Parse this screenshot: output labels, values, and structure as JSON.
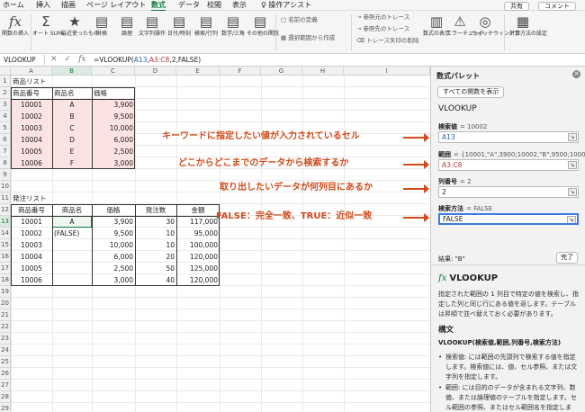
{
  "tabs": [
    "ホーム",
    "挿入",
    "描画",
    "ページ レイアウト",
    "数式",
    "データ",
    "校閲",
    "表示",
    "操作アシスト"
  ],
  "active_tab": "数式",
  "top_right": {
    "share": "共有",
    "comment": "コメント"
  },
  "ribbon": {
    "insert_function": "関数の挿入",
    "autosum": "オート SUM",
    "recent": "最近使ったもの",
    "financial": "財務",
    "logical": "論理",
    "text": "文字列操作",
    "datetime": "日付/時刻",
    "lookup": "検索/行列",
    "math": "数学/三角",
    "more": "その他の関数",
    "define_name": "名前の定義",
    "create_from_selection": "選択範囲から作成",
    "trace_precedents": "参照元のトレース",
    "trace_dependents": "参照先のトレース",
    "remove_arrows": "トレース矢印の削除",
    "show_formulas": "数式の表示",
    "error_check": "エラーチェック",
    "watch": "ウォッチウィンドウ",
    "calc_options": "計算方法の設定"
  },
  "formula_bar": {
    "name_box": "VLOOKUP",
    "fx": "fx",
    "formula_pre": "=VLOOKUP(",
    "formula_arg1": "A13",
    "formula_sep": ",",
    "formula_arg2": "A3:C8",
    "formula_post": ",2,FALSE)"
  },
  "columns": [
    "A",
    "B",
    "C",
    "D",
    "E",
    "F",
    "G",
    "H",
    "I"
  ],
  "rows": [
    "1",
    "2",
    "3",
    "4",
    "5",
    "6",
    "7",
    "8",
    "9",
    "10",
    "11",
    "12",
    "13",
    "14",
    "15",
    "16",
    "17",
    "18",
    "19",
    "20",
    "21",
    "22",
    "23",
    "24",
    "25",
    "26",
    "27",
    "28",
    "29"
  ],
  "product_list": {
    "title": "商品リスト",
    "headers": [
      "商品番号",
      "商品名",
      "価格"
    ],
    "rows": [
      [
        "10001",
        "A",
        "3,900"
      ],
      [
        "10002",
        "B",
        "9,500"
      ],
      [
        "10003",
        "C",
        "10,000"
      ],
      [
        "10004",
        "D",
        "6,000"
      ],
      [
        "10005",
        "E",
        "2,500"
      ],
      [
        "10006",
        "F",
        "3,000"
      ]
    ]
  },
  "order_list": {
    "title": "発注リスト",
    "headers": [
      "商品番号",
      "商品名",
      "価格",
      "発注数",
      "金額"
    ],
    "rows": [
      [
        "10001",
        "A",
        "3,900",
        "30",
        "117,000"
      ],
      [
        "10002",
        "(FALSE)",
        "9,500",
        "10",
        "95,000"
      ],
      [
        "10003",
        "",
        "10,000",
        "10",
        "100,000"
      ],
      [
        "10004",
        "",
        "6,000",
        "20",
        "120,000"
      ],
      [
        "10005",
        "",
        "2,500",
        "50",
        "125,000"
      ],
      [
        "10006",
        "",
        "3,000",
        "40",
        "120,000"
      ]
    ]
  },
  "annotations": [
    "キーワードに指定したい値が入力されているセル",
    "どこからどこまでのデータから検索するか",
    "取り出したいデータが何列目にあるか",
    "FALSE：完全一致、TRUE：近似一致"
  ],
  "panel": {
    "title": "数式パレット",
    "all_functions": "すべての関数を表示",
    "function": "VLOOKUP",
    "args": [
      {
        "label": "検索値",
        "eq": "=",
        "value": "10002",
        "input": "A13"
      },
      {
        "label": "範囲",
        "eq": "=",
        "value": "{10001,\"A\",3900;10002,\"B\",9500;10003,\"C\",1...",
        "input": "A3:C8"
      },
      {
        "label": "列番号",
        "eq": "=",
        "value": "2",
        "input": "2"
      },
      {
        "label": "検索方法",
        "eq": "=",
        "value": "FALSE",
        "input": "FALSE"
      }
    ],
    "result": "結果: \"B\"",
    "done": "完了",
    "fx_title": "VLOOKUP",
    "description": "指定された範囲の 1 列目で特定の値を検索し、指定した列と同じ行にある値を返します。テーブルは昇順で並べ替えておく必要があります。",
    "syntax_heading": "構文",
    "syntax": "VLOOKUP(検索値,範囲,列番号,検索方法)",
    "bullets": [
      "検索値: には範囲の先頭列で検索する値を指定します。検索値には、値、セル参照、または文字列を指定します。",
      "範囲: には目的のデータが含まれる文字列、数値、または論理値のテーブルを指定します。セル範囲の参照、またはセル範囲名を指定します。"
    ]
  }
}
